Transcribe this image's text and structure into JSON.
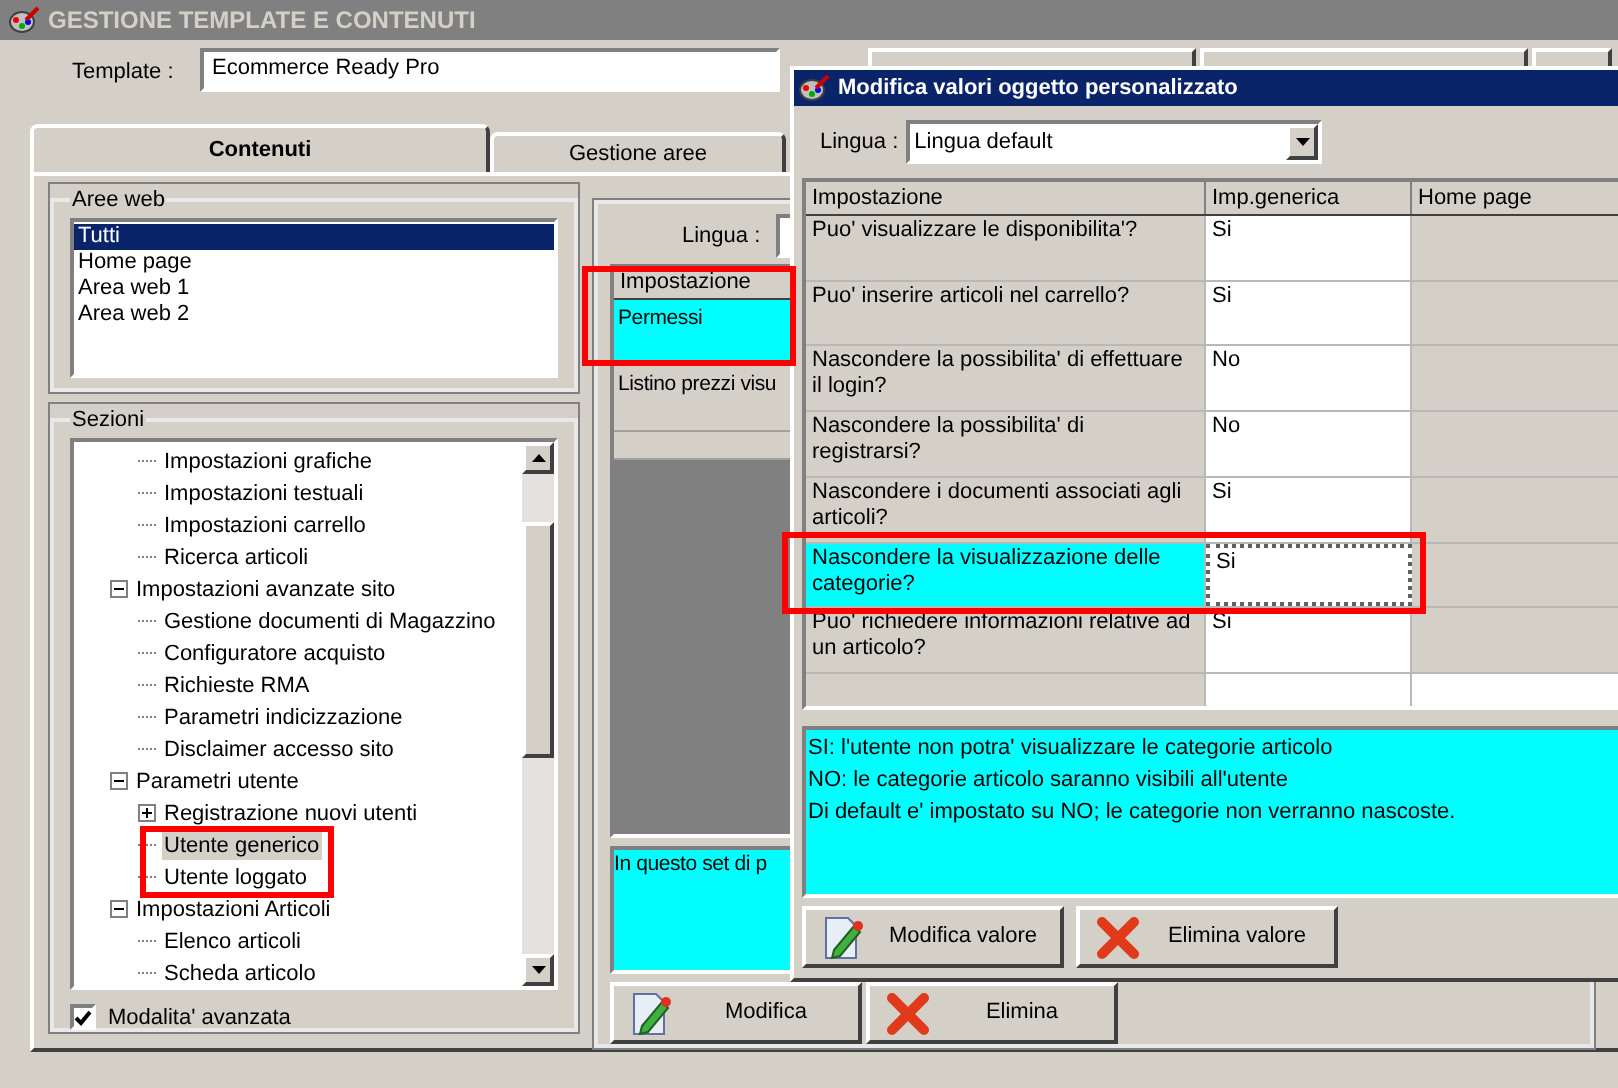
{
  "main_window": {
    "title": "GESTIONE TEMPLATE E CONTENUTI",
    "template_label": "Template :",
    "template_value": "Ecommerce Ready Pro",
    "tabs": [
      {
        "label": "Contenuti",
        "selected": true
      },
      {
        "label": "Gestione aree",
        "selected": false
      }
    ],
    "aree_web": {
      "title": "Aree web",
      "items": [
        {
          "label": "Tutti",
          "selected": true
        },
        {
          "label": "Home page",
          "selected": false
        },
        {
          "label": "Area web 1",
          "selected": false
        },
        {
          "label": "Area web 2",
          "selected": false
        }
      ]
    },
    "sezioni": {
      "title": "Sezioni",
      "tree": [
        {
          "children": [
            {
              "label": "Impostazioni grafiche",
              "selected": false
            },
            {
              "label": "Impostazioni testuali",
              "selected": false
            },
            {
              "label": "Impostazioni carrello",
              "selected": false
            },
            {
              "label": "Ricerca articoli",
              "selected": false
            }
          ]
        },
        {
          "label": "Impostazioni avanzate sito",
          "selected": false,
          "expanded": true,
          "children": [
            {
              "label": "Gestione documenti di Magazzino",
              "selected": false
            },
            {
              "label": "Configuratore acquisto",
              "selected": false
            },
            {
              "label": "Richieste RMA",
              "selected": false
            },
            {
              "label": "Parametri indicizzazione",
              "selected": false
            },
            {
              "label": "Disclaimer accesso sito",
              "selected": false
            }
          ]
        },
        {
          "label": "Parametri utente",
          "selected": false,
          "expanded": true,
          "children": [
            {
              "label": "Registrazione nuovi utenti",
              "selected": false,
              "expanded": false
            },
            {
              "label": "Utente generico",
              "selected": true
            },
            {
              "label": "Utente loggato",
              "selected": false
            }
          ]
        },
        {
          "label": "Impostazioni Articoli",
          "selected": false,
          "expanded": true,
          "children": [
            {
              "label": "Elenco articoli",
              "selected": false
            },
            {
              "label": "Scheda articolo",
              "selected": false
            }
          ]
        }
      ],
      "advanced_mode": {
        "label": "Modalita' avanzata",
        "checked": true
      }
    },
    "settings_panel": {
      "language_label": "Lingua :",
      "grid_header": "Impostazione",
      "rows": [
        {
          "label": "Permessi",
          "selected": true
        },
        {
          "label": "Listino prezzi visu",
          "selected": false
        }
      ],
      "description": "In questo set di p",
      "buttons": [
        {
          "label": "Modifica",
          "kind": "edit"
        },
        {
          "label": "Elimina",
          "kind": "delete"
        }
      ]
    }
  },
  "dialog": {
    "title": "Modifica valori oggetto personalizzato",
    "language_label": "Lingua :",
    "language_value": "Lingua default",
    "columns": [
      "Impostazione",
      "Imp.generica",
      "Home page"
    ],
    "rows": [
      {
        "setting": "Puo' visualizzare le disponibilita'?",
        "value": "Si",
        "selected": false
      },
      {
        "setting": "Puo' inserire articoli nel carrello?",
        "value": "Si",
        "selected": false
      },
      {
        "setting": "Nascondere la possibilita' di effettuare il login?",
        "value": "No",
        "selected": false
      },
      {
        "setting": "Nascondere la possibilita' di registrarsi?",
        "value": "No",
        "selected": false
      },
      {
        "setting": "Nascondere i documenti associati agli articoli?",
        "value": "Si",
        "selected": false
      },
      {
        "setting": "Nascondere la visualizzazione delle categorie?",
        "value": "Si",
        "selected": true
      },
      {
        "setting": "Puo' richiedere informazioni relative ad un articolo?",
        "value": "Si",
        "selected": false
      }
    ],
    "description_lines": [
      "SI: l'utente non potra' visualizzare le categorie articolo",
      "NO: le categorie articolo saranno visibili all'utente",
      "Di default e' impostato su NO; le categorie non verranno nascoste."
    ],
    "buttons": [
      {
        "label": "Modifica valore",
        "kind": "edit"
      },
      {
        "label": "Elimina valore",
        "kind": "delete"
      }
    ]
  }
}
